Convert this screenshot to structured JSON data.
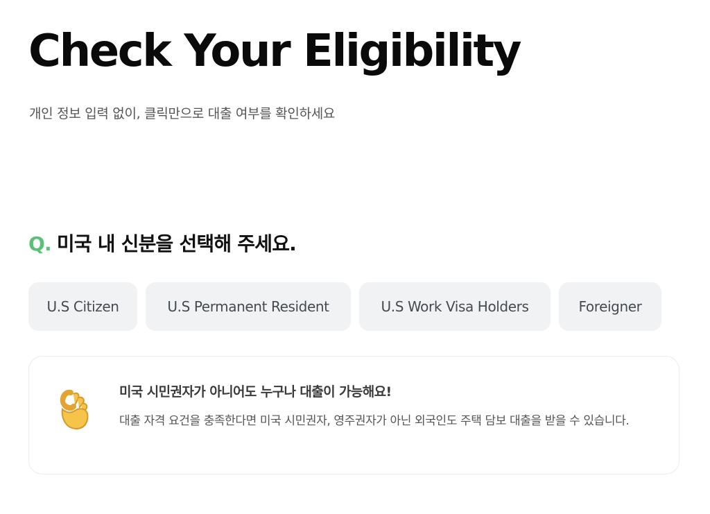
{
  "header": {
    "title": "Check Your Eligibility",
    "subtitle": "개인 정보 입력 없이, 클릭만으로 대출 여부를 확인하세요"
  },
  "question": {
    "prefix": "Q.",
    "text": "미국 내 신분을 선택해 주세요."
  },
  "options": [
    {
      "label": "U.S Citizen"
    },
    {
      "label": "U.S Permanent Resident"
    },
    {
      "label": "U.S Work Visa Holders"
    },
    {
      "label": "Foreigner"
    }
  ],
  "info_card": {
    "icon": "ok-hand-emoji-icon",
    "title": "미국 시민권자가 아니어도 누구나 대출이 가능해요!",
    "body": "대출 자격 요건을 충족한다면 미국 시민권자, 영주권자가 아닌 외국인도 주택 담보 대출을 받을 수 있습니다."
  },
  "colors": {
    "accent": "#5cc178",
    "option_bg": "#f1f2f4",
    "card_border": "#ebebeb"
  }
}
